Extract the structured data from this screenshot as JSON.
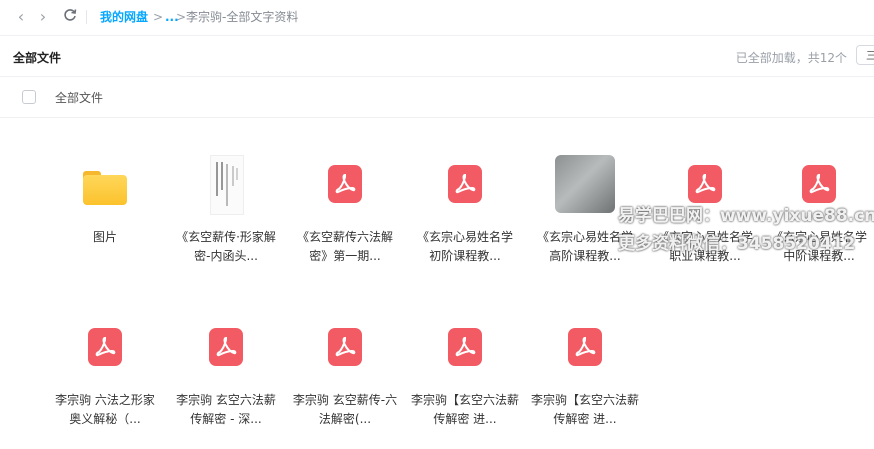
{
  "breadcrumb": {
    "root": "我的网盘",
    "sep1": ">",
    "ellipsis": "...",
    "sep2": ">",
    "current": "李宗驹-全部文字资料"
  },
  "header": {
    "title": "全部文件",
    "status": "已全部加载，共12个",
    "view_label": "三"
  },
  "select_all_label": "全部文件",
  "files": [
    {
      "name": "图片",
      "type": "folder"
    },
    {
      "name": "《玄空薪传·形家解密-内函头...",
      "type": "doc-thumb"
    },
    {
      "name": "《玄空薪传六法解密》第一期...",
      "type": "pdf"
    },
    {
      "name": "《玄宗心易姓名学 初阶课程教...",
      "type": "pdf"
    },
    {
      "name": "《玄宗心易姓名学 高阶课程教...",
      "type": "photo-thumb"
    },
    {
      "name": "《玄宗心易姓名学 职业课程教...",
      "type": "pdf"
    },
    {
      "name": "《玄宗心易姓名学 中阶课程教...",
      "type": "pdf"
    },
    {
      "name": "李宗驹 六法之形家奥义解秘（...",
      "type": "pdf"
    },
    {
      "name": "李宗驹 玄空六法薪传解密 - 深...",
      "type": "pdf"
    },
    {
      "name": "李宗驹 玄空薪传-六法解密(...",
      "type": "pdf"
    },
    {
      "name": "李宗驹【玄空六法薪传解密 进...",
      "type": "pdf"
    },
    {
      "name": "李宗驹【玄空六法薪传解密 进...",
      "type": "pdf"
    }
  ],
  "watermark": {
    "line1": "易学巴巴网：www.yixue88.cn",
    "line2": "更多资料微信：3458520412"
  },
  "icons": {
    "back": "chevron-left-icon",
    "forward": "chevron-right-icon",
    "refresh": "refresh-icon",
    "pdf_color": "#f25b63",
    "link_color": "#06a7ff"
  }
}
